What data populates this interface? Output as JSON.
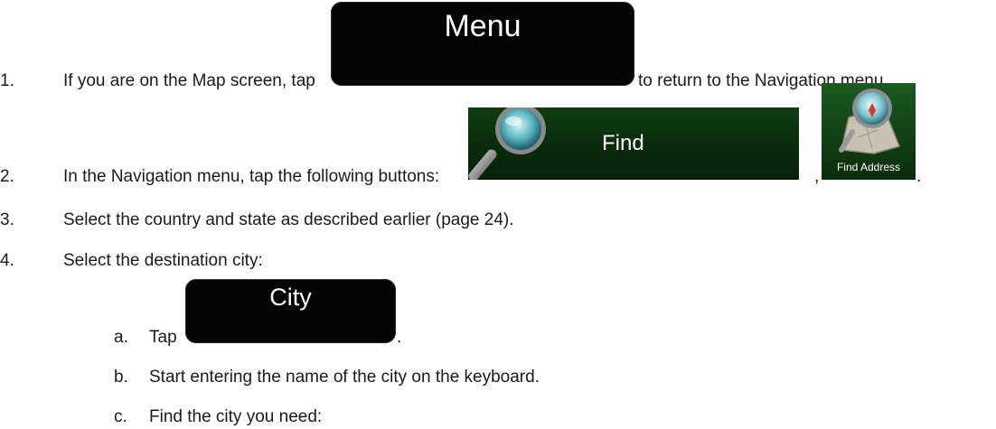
{
  "steps": [
    {
      "num": "1.",
      "pre": "If you are on the Map screen, tap",
      "post": "to return to the Navigation menu."
    },
    {
      "num": "2.",
      "pre": "In the Navigation menu, tap the following buttons:",
      "sep": ",",
      "end": "."
    },
    {
      "num": "3.",
      "text": "Select the country and state as described earlier (page 24)."
    },
    {
      "num": "4.",
      "text": "Select the destination city:"
    }
  ],
  "substeps": [
    {
      "letter": "a.",
      "text": "Tap",
      "end": "."
    },
    {
      "letter": "b.",
      "text": "Start entering the name of the city on the keyboard."
    },
    {
      "letter": "c.",
      "text": "Find the city you need:"
    }
  ],
  "buttons": {
    "menu": "Menu",
    "find": "Find",
    "find_address": "Find Address",
    "city": "City"
  },
  "colors": {
    "button_black": "#050505",
    "button_green": "#0a2a0c"
  }
}
